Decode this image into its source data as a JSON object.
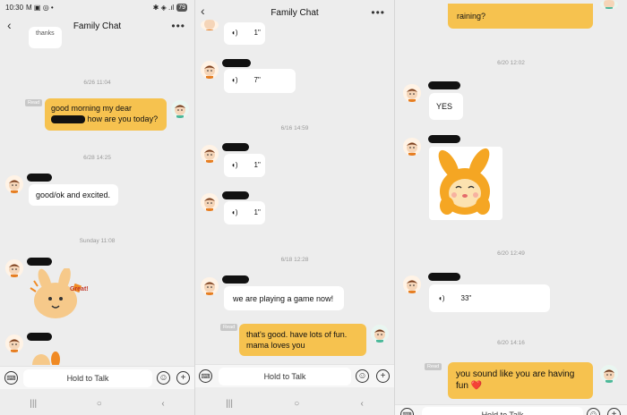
{
  "status_bar": {
    "time": "10:30",
    "left_icons": "M ▣ ◎ •",
    "right_icons": "✱ ◈ .ıl",
    "battery": "79"
  },
  "header": {
    "title": "Family Chat",
    "back_icon": "‹",
    "more_icon": "•••"
  },
  "panel1": {
    "top_bubble": "thanks",
    "ts1": "6/26 11:04",
    "read1": "Read",
    "msg_me1_line1": "good morning my dear",
    "msg_me1_line2": "how are you today?",
    "ts2": "6/28 14:25",
    "msg_other1": "good/ok and excited.",
    "ts3": "Sunday 11:08",
    "sticker_text": "Great!"
  },
  "panel2": {
    "voice1": "1\"",
    "voice2": "7\"",
    "ts1": "6/16 14:59",
    "voice3": "1\"",
    "voice4": "1\"",
    "ts2": "6/18 12:28",
    "msg_other": "we are playing a game now!",
    "read": "Read",
    "msg_me_line1": "that's good. have lots of fun.",
    "msg_me_line2": "mama loves you"
  },
  "panel3": {
    "top_me": "raining?",
    "ts1": "6/20 12:02",
    "msg_yes": "YES",
    "ts2": "6/20 12:49",
    "voice": "33\"",
    "ts3": "6/20 14:16",
    "read": "Read",
    "msg_me_line1": "you sound like you are having",
    "msg_me_line2": "fun ❤️"
  },
  "input_bar": {
    "hold_to_talk": "Hold to Talk",
    "emoji_icon": "☺",
    "plus_icon": "+",
    "keyboard_icon": "⌨"
  },
  "nav_bar": {
    "recents": "|||",
    "home": "○",
    "back": "‹"
  },
  "colors": {
    "bg": "#ededed",
    "my_bubble": "#f6c24f",
    "other_bubble": "#ffffff",
    "timestamp": "#999999"
  }
}
